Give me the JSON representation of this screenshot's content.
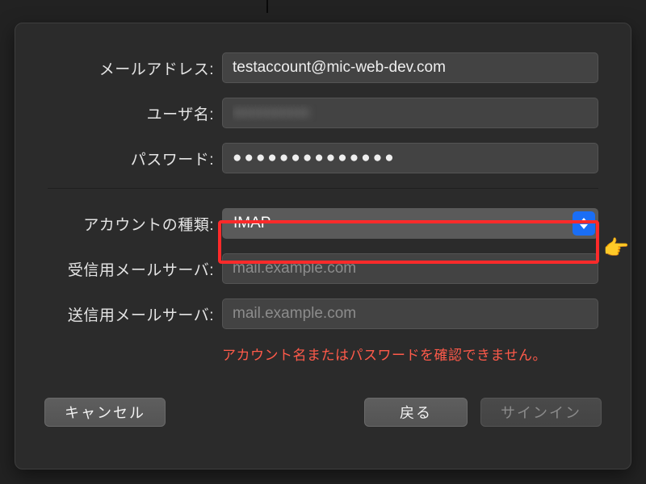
{
  "form": {
    "email_label": "メールアドレス:",
    "email_value": "testaccount@mic-web-dev.com",
    "username_label": "ユーザ名:",
    "username_value": "xxxxxxxxxx",
    "password_label": "パスワード:",
    "password_value": "●●●●●●●●●●●●●●",
    "account_type_label": "アカウントの種類:",
    "account_type_value": "IMAP",
    "incoming_label": "受信用メールサーバ:",
    "incoming_placeholder": "mail.example.com",
    "outgoing_label": "送信用メールサーバ:",
    "outgoing_placeholder": "mail.example.com",
    "error_message": "アカウント名またはパスワードを確認できません。"
  },
  "buttons": {
    "cancel": "キャンセル",
    "back": "戻る",
    "signin": "サインイン"
  }
}
